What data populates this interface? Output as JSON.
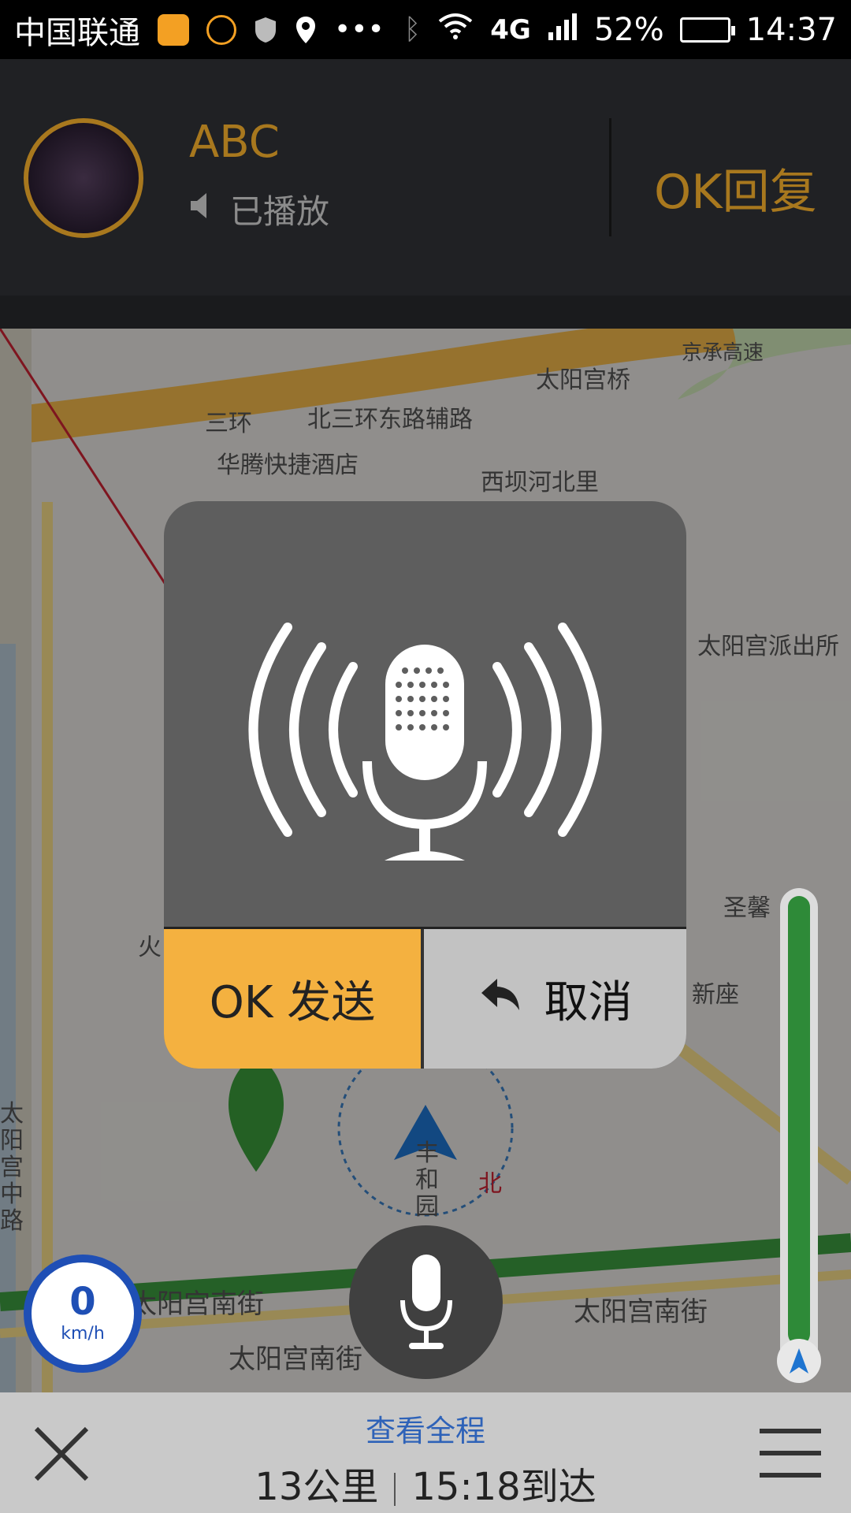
{
  "status_bar": {
    "carrier": "中国联通",
    "network": "4G",
    "battery": "52%",
    "time": "14:37",
    "icons": [
      "nav-app-icon",
      "face-icon",
      "shield-icon",
      "location-icon",
      "more-icon",
      "bluetooth-icon",
      "wifi-icon",
      "signal-icon",
      "battery-icon"
    ]
  },
  "message": {
    "sender": "ABC",
    "status": "已播放",
    "reply_label": "OK回复"
  },
  "map": {
    "labels": {
      "road_top": "北三环东路辅路",
      "sanhuan": "三环",
      "taiyanggong_bridge": "太阳宫桥",
      "jingcheng": "京承高速",
      "hotel": "华腾快捷酒店",
      "xiba": "西坝河北里",
      "police": "太阳宫派出所",
      "shengxin": "圣馨",
      "xinzuo": "新座",
      "huo": "火",
      "road_vertical": "太阳宫中路",
      "fenghe": "丰和园",
      "south_st_1": "太阳宫南街",
      "south_st_2": "太阳宫南街",
      "south_st_3": "太阳宫南街",
      "north": "北"
    }
  },
  "speed": {
    "value": "0",
    "unit": "km/h"
  },
  "bottom_bar": {
    "overview": "查看全程",
    "distance": "13公里",
    "arrival": "15:18到达"
  },
  "dialog": {
    "send_label": "OK 发送",
    "cancel_label": "取消"
  }
}
